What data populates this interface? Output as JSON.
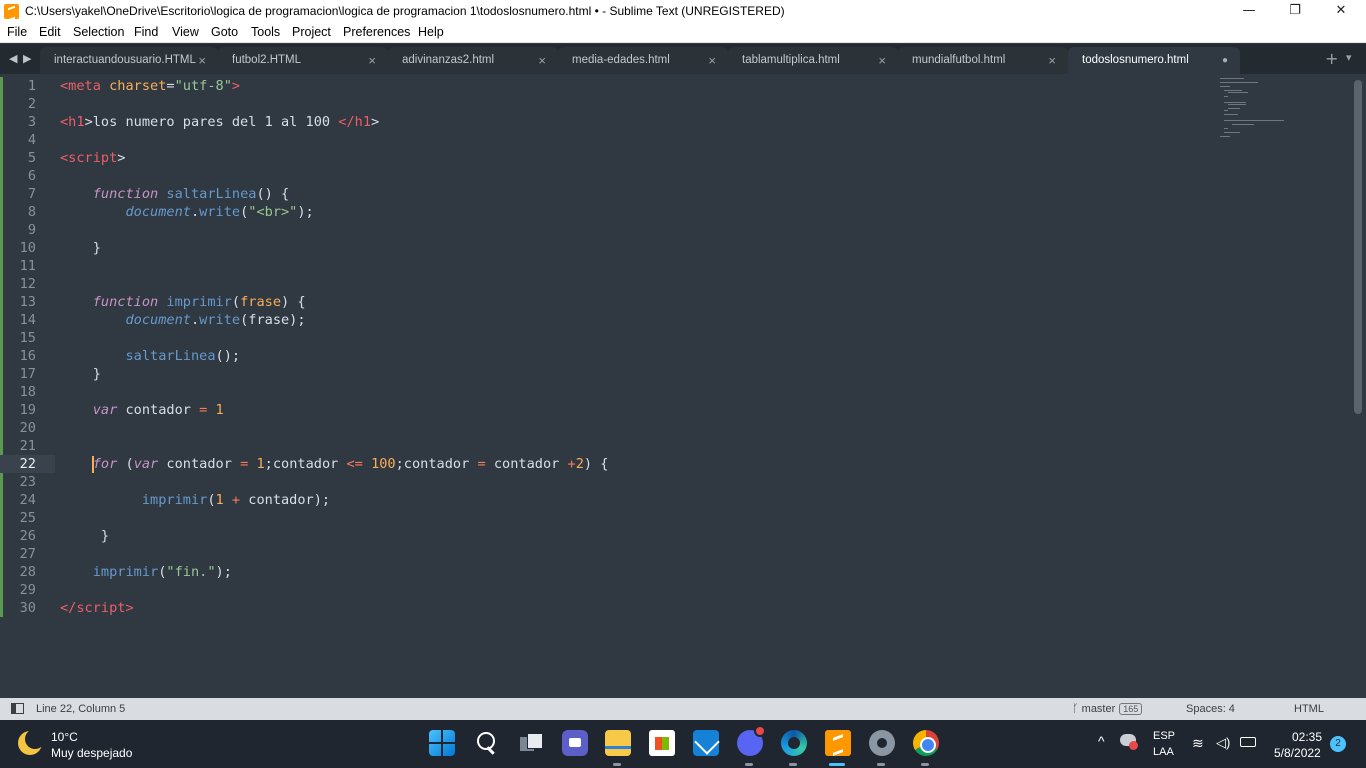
{
  "window": {
    "title": "C:\\Users\\yakel\\OneDrive\\Escritorio\\logica de programacion\\logica de programacion 1\\todoslosnumero.html • - Sublime Text (UNREGISTERED)",
    "controls": {
      "minimize": "—",
      "maximize": "❐",
      "close": "✕"
    }
  },
  "menu": [
    "File",
    "Edit",
    "Selection",
    "Find",
    "View",
    "Goto",
    "Tools",
    "Project",
    "Preferences",
    "Help"
  ],
  "tabs": [
    {
      "label": "interactuandousuario.HTML",
      "active": false
    },
    {
      "label": "futbol2.HTML",
      "active": false
    },
    {
      "label": "adivinanzas2.html",
      "active": false
    },
    {
      "label": "media-edades.html",
      "active": false
    },
    {
      "label": "tablamultiplica.html",
      "active": false
    },
    {
      "label": "mundialfutbol.html",
      "active": false
    },
    {
      "label": "todoslosnumero.html",
      "active": true,
      "dirty": true
    }
  ],
  "editor": {
    "current_line": 22,
    "lines": [
      {
        "n": "1",
        "tokens": [
          [
            "t-tag",
            "<meta "
          ],
          [
            "t-attr",
            "charset"
          ],
          [
            "t-p",
            "="
          ],
          [
            "t-str",
            "\"utf-8\""
          ],
          [
            "t-tag",
            ">"
          ]
        ]
      },
      {
        "n": "2",
        "tokens": []
      },
      {
        "n": "3",
        "tokens": [
          [
            "t-tag",
            "<h1"
          ],
          [
            "t-p",
            ">los numero pares del 1 al 100 "
          ],
          [
            "t-tag",
            "</h1"
          ],
          [
            "t-p",
            ">"
          ]
        ]
      },
      {
        "n": "4",
        "tokens": []
      },
      {
        "n": "5",
        "tokens": [
          [
            "t-tag",
            "<script"
          ],
          [
            "t-p",
            ">"
          ]
        ]
      },
      {
        "n": "6",
        "tokens": []
      },
      {
        "n": "7",
        "tokens": [
          [
            "t-p",
            "    "
          ],
          [
            "t-kw",
            "function"
          ],
          [
            "t-p",
            " "
          ],
          [
            "t-fn",
            "saltarLinea"
          ],
          [
            "t-p",
            "() {"
          ]
        ]
      },
      {
        "n": "8",
        "tokens": [
          [
            "t-p",
            "        "
          ],
          [
            "t-obj",
            "document"
          ],
          [
            "t-p",
            "."
          ],
          [
            "t-fn",
            "write"
          ],
          [
            "t-p",
            "("
          ],
          [
            "t-str",
            "\"<br>\""
          ],
          [
            "t-p",
            ");"
          ]
        ]
      },
      {
        "n": "9",
        "tokens": []
      },
      {
        "n": "10",
        "tokens": [
          [
            "t-p",
            "    }"
          ]
        ]
      },
      {
        "n": "11",
        "tokens": []
      },
      {
        "n": "12",
        "tokens": []
      },
      {
        "n": "13",
        "tokens": [
          [
            "t-p",
            "    "
          ],
          [
            "t-kw",
            "function"
          ],
          [
            "t-p",
            " "
          ],
          [
            "t-fn",
            "imprimir"
          ],
          [
            "t-p",
            "("
          ],
          [
            "t-attr",
            "frase"
          ],
          [
            "t-p",
            ") {"
          ]
        ]
      },
      {
        "n": "14",
        "tokens": [
          [
            "t-p",
            "        "
          ],
          [
            "t-obj",
            "document"
          ],
          [
            "t-p",
            "."
          ],
          [
            "t-fn",
            "write"
          ],
          [
            "t-p",
            "(frase);"
          ]
        ]
      },
      {
        "n": "15",
        "tokens": []
      },
      {
        "n": "16",
        "tokens": [
          [
            "t-p",
            "        "
          ],
          [
            "t-fn",
            "saltarLinea"
          ],
          [
            "t-p",
            "();"
          ]
        ]
      },
      {
        "n": "17",
        "tokens": [
          [
            "t-p",
            "    }"
          ]
        ]
      },
      {
        "n": "18",
        "tokens": []
      },
      {
        "n": "19",
        "tokens": [
          [
            "t-p",
            "    "
          ],
          [
            "t-kw",
            "var"
          ],
          [
            "t-p",
            " contador "
          ],
          [
            "t-op",
            "="
          ],
          [
            "t-p",
            " "
          ],
          [
            "t-num",
            "1"
          ]
        ]
      },
      {
        "n": "20",
        "tokens": []
      },
      {
        "n": "21",
        "tokens": []
      },
      {
        "n": "22",
        "tokens": [
          [
            "t-p",
            "    "
          ],
          [
            "t-kw",
            "for"
          ],
          [
            "t-p",
            " ("
          ],
          [
            "t-kw",
            "var"
          ],
          [
            "t-p",
            " contador "
          ],
          [
            "t-op",
            "="
          ],
          [
            "t-p",
            " "
          ],
          [
            "t-num",
            "1"
          ],
          [
            "t-p",
            ";contador "
          ],
          [
            "t-op",
            "<="
          ],
          [
            "t-p",
            " "
          ],
          [
            "t-num",
            "100"
          ],
          [
            "t-p",
            ";contador "
          ],
          [
            "t-op",
            "="
          ],
          [
            "t-p",
            " contador "
          ],
          [
            "t-op",
            "+"
          ],
          [
            "t-num",
            "2"
          ],
          [
            "t-p",
            ") {"
          ]
        ]
      },
      {
        "n": "23",
        "tokens": []
      },
      {
        "n": "24",
        "tokens": [
          [
            "t-p",
            "          "
          ],
          [
            "t-fn",
            "imprimir"
          ],
          [
            "t-p",
            "("
          ],
          [
            "t-num",
            "1"
          ],
          [
            "t-p",
            " "
          ],
          [
            "t-op",
            "+"
          ],
          [
            "t-p",
            " contador);"
          ]
        ]
      },
      {
        "n": "25",
        "tokens": []
      },
      {
        "n": "26",
        "tokens": [
          [
            "t-p",
            "     }"
          ]
        ]
      },
      {
        "n": "27",
        "tokens": []
      },
      {
        "n": "28",
        "tokens": [
          [
            "t-p",
            "    "
          ],
          [
            "t-fn",
            "imprimir"
          ],
          [
            "t-p",
            "("
          ],
          [
            "t-str",
            "\"fin.\""
          ],
          [
            "t-p",
            ");"
          ]
        ]
      },
      {
        "n": "29",
        "tokens": []
      },
      {
        "n": "30",
        "tokens": [
          [
            "t-tag",
            "</script"
          ],
          [
            "t-tag",
            ">"
          ]
        ]
      }
    ]
  },
  "status": {
    "position": "Line 22, Column 5",
    "branch": "master",
    "branch_count": "165",
    "indent": "Spaces: 4",
    "syntax": "HTML"
  },
  "taskbar": {
    "weather_temp": "10°C",
    "weather_desc": "Muy despejado",
    "apps": [
      "start-icon",
      "search-icon",
      "task-view-icon",
      "teams-chat-icon",
      "file-explorer-icon",
      "microsoft-store-icon",
      "mail-icon",
      "discord-icon",
      "edge-icon",
      "sublime-text-icon",
      "settings-icon",
      "chrome-icon"
    ],
    "lang_top": "ESP",
    "lang_bottom": "LAA",
    "time": "02:35",
    "date": "5/8/2022",
    "notifications": "2"
  }
}
